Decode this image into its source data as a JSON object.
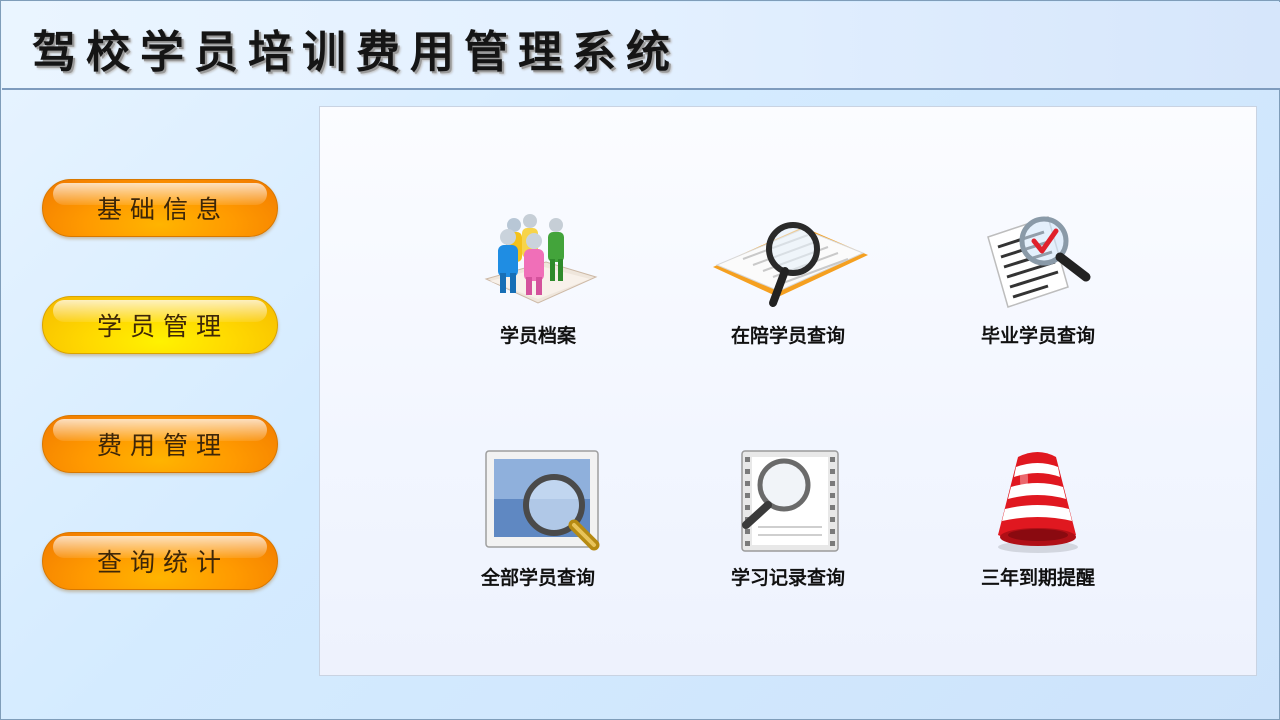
{
  "header": {
    "title": "驾校学员培训费用管理系统"
  },
  "sidebar": {
    "items": [
      {
        "label": "基础信息",
        "color": "#ff9a00"
      },
      {
        "label": "学员管理",
        "color": "#ffd800"
      },
      {
        "label": "费用管理",
        "color": "#ff9a00"
      },
      {
        "label": "查询统计",
        "color": "#ff9a00"
      }
    ]
  },
  "main": {
    "tiles": [
      {
        "label": "学员档案",
        "icon": "people-icon"
      },
      {
        "label": "在陪学员查询",
        "icon": "book-magnifier-icon"
      },
      {
        "label": "毕业学员查询",
        "icon": "document-check-magnifier-icon"
      },
      {
        "label": "全部学员查询",
        "icon": "screen-magnifier-icon"
      },
      {
        "label": "学习记录查询",
        "icon": "film-magnifier-icon"
      },
      {
        "label": "三年到期提醒",
        "icon": "alarm-bell-icon"
      }
    ]
  }
}
